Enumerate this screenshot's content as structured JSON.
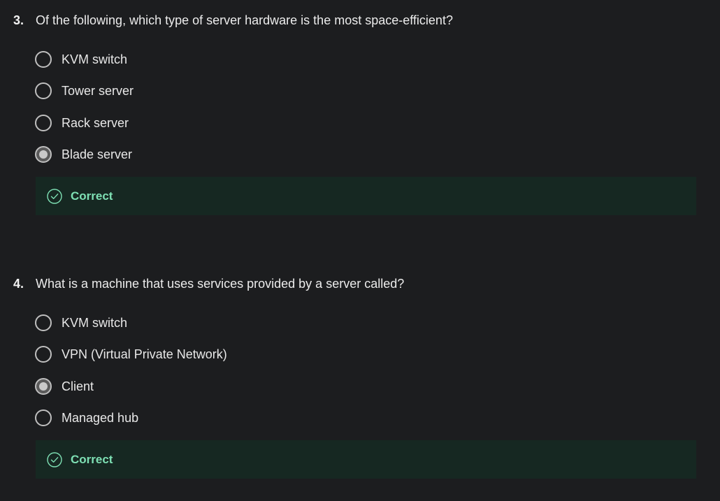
{
  "questions": [
    {
      "number": "3.",
      "text": "Of the following, which type of server hardware is the most space-efficient?",
      "options": [
        {
          "label": "KVM switch",
          "selected": false
        },
        {
          "label": "Tower server",
          "selected": false
        },
        {
          "label": "Rack server",
          "selected": false
        },
        {
          "label": "Blade server",
          "selected": true
        }
      ],
      "feedback": {
        "text": "Correct",
        "icon": "check-circle-icon",
        "color": "#7ee0b4",
        "background": "#162822"
      }
    },
    {
      "number": "4.",
      "text": "What is a machine that uses services provided by a server called?",
      "options": [
        {
          "label": "KVM switch",
          "selected": false
        },
        {
          "label": "VPN (Virtual Private Network)",
          "selected": false
        },
        {
          "label": "Client",
          "selected": true
        },
        {
          "label": "Managed hub",
          "selected": false
        }
      ],
      "feedback": {
        "text": "Correct",
        "icon": "check-circle-icon",
        "color": "#7ee0b4",
        "background": "#162822"
      }
    }
  ]
}
